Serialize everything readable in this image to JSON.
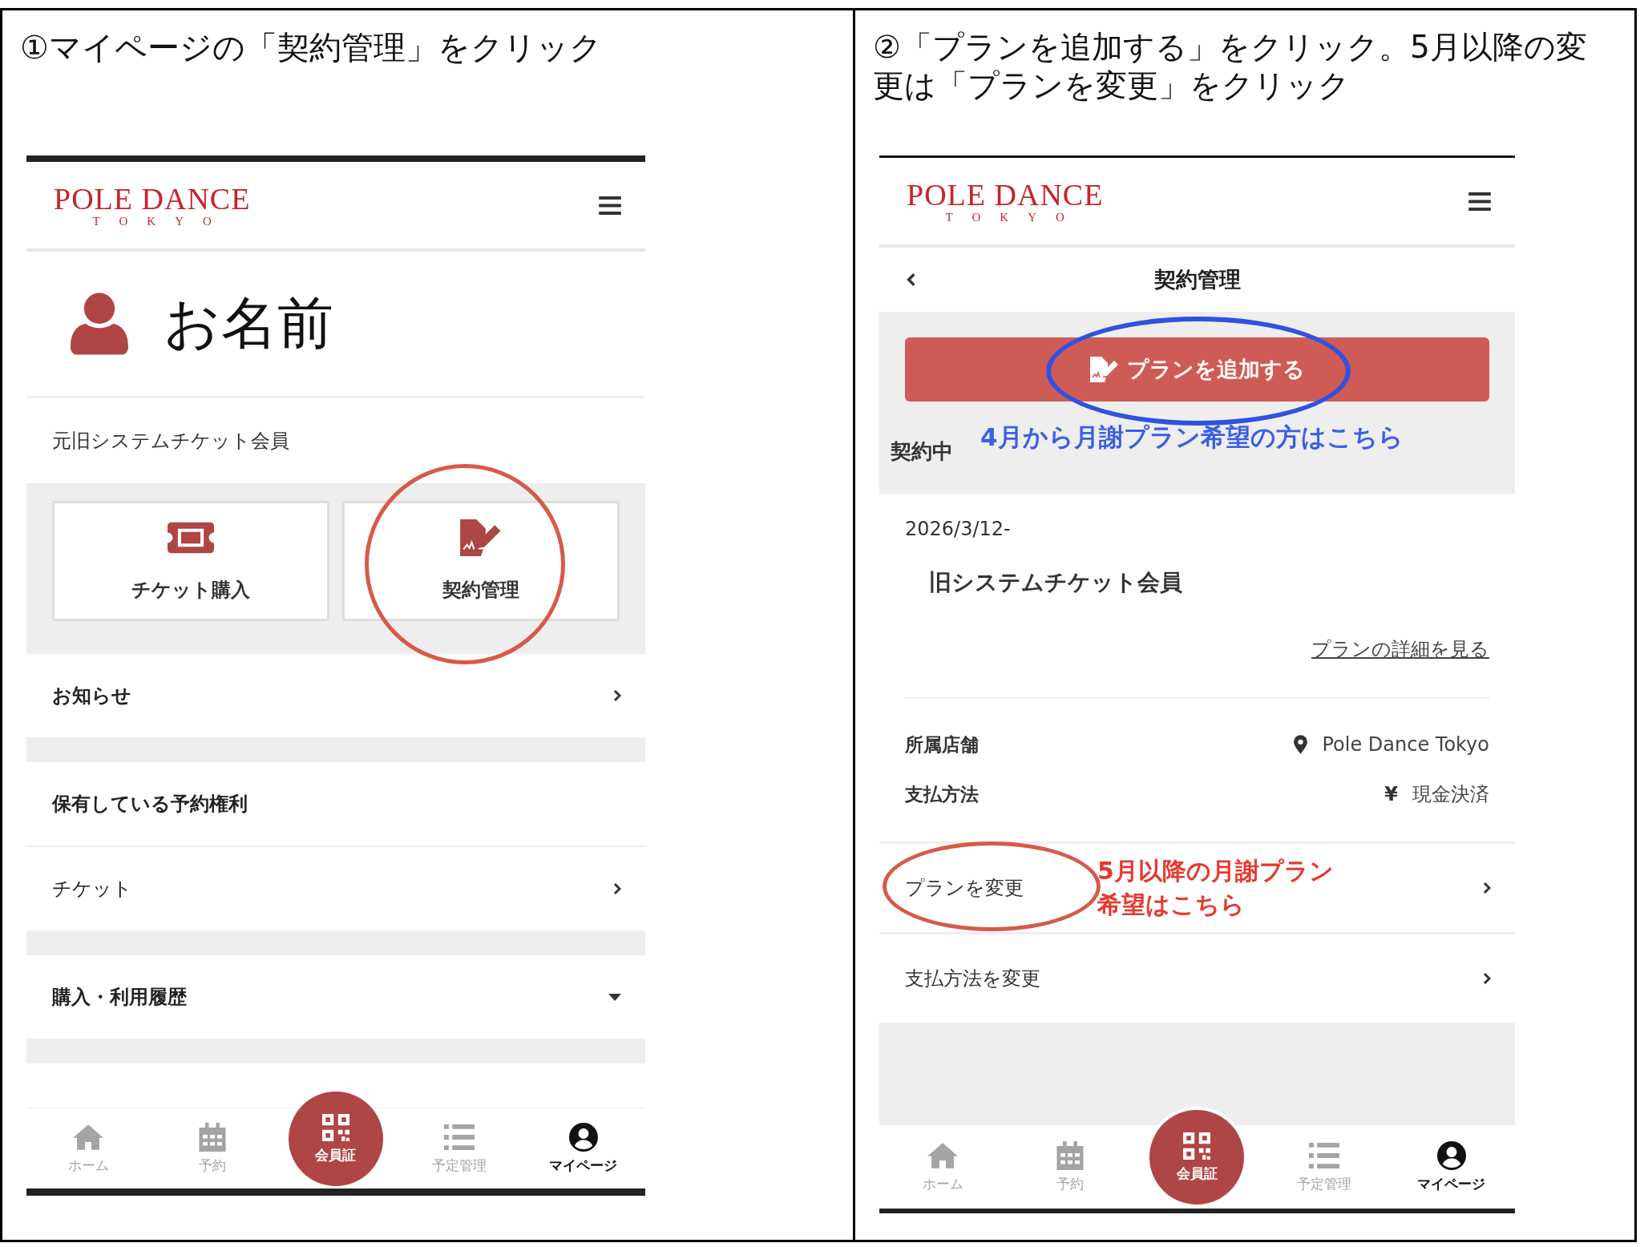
{
  "left_panel": {
    "instruction": "①マイページの「契約管理」をクリック",
    "header": {
      "logo": "POLE DANCE",
      "logo_sub": "TOKYO"
    },
    "profile": {
      "name": "お名前"
    },
    "member_type": "元旧システムチケット会員",
    "cards": [
      {
        "label": "チケット購入",
        "kind": "ticket",
        "circled": false
      },
      {
        "label": "契約管理",
        "kind": "contract",
        "circled": true
      }
    ],
    "groups": [
      [
        {
          "label": "お知らせ",
          "kind": "link",
          "bold": true
        }
      ],
      [
        {
          "label": "保有している予約権利",
          "kind": "heading",
          "bold": true
        },
        {
          "label": "チケット",
          "kind": "link",
          "bold": false
        }
      ],
      [
        {
          "label": "購入・利用履歴",
          "kind": "dropdown",
          "bold": true
        }
      ]
    ],
    "nav": [
      {
        "label": "ホーム",
        "kind": "tab",
        "selected": false
      },
      {
        "label": "予約",
        "kind": "tab",
        "selected": false
      },
      {
        "label": "会員証",
        "kind": "center",
        "selected": false
      },
      {
        "label": "予定管理",
        "kind": "tab",
        "selected": false
      },
      {
        "label": "マイページ",
        "kind": "tab",
        "selected": true
      }
    ]
  },
  "right_panel": {
    "instruction": "②「プランを追加する」をクリック。5月以降の変更は「プランを変更」をクリック",
    "header": {
      "logo": "POLE DANCE",
      "logo_sub": "TOKYO"
    },
    "title_bar": {
      "title": "契約管理"
    },
    "add_button": {
      "label": "プランを追加する",
      "circled": true
    },
    "status": "契約中",
    "note": "4月から月謝プラン希望の方はこちら",
    "contract": {
      "date": "2026/3/12-",
      "plan": "旧システムチケット会員",
      "detail_link": "プランの詳細を見る"
    },
    "info": [
      {
        "kind": "store",
        "label": "所属店舗",
        "value": "Pole Dance Tokyo"
      },
      {
        "kind": "payment",
        "label": "支払方法",
        "symbol": "¥",
        "value": "現金決済"
      }
    ],
    "actions": [
      {
        "label": "プランを変更",
        "circled": true,
        "note": [
          "5月以降の月謝プラン",
          "希望はこちら"
        ]
      },
      {
        "label": "支払方法を変更",
        "circled": false
      }
    ],
    "nav": [
      {
        "label": "ホーム",
        "kind": "tab",
        "selected": false
      },
      {
        "label": "予約",
        "kind": "tab",
        "selected": false
      },
      {
        "label": "会員証",
        "kind": "center",
        "selected": false
      },
      {
        "label": "予定管理",
        "kind": "tab",
        "selected": false
      },
      {
        "label": "マイページ",
        "kind": "tab",
        "selected": true
      }
    ]
  }
}
